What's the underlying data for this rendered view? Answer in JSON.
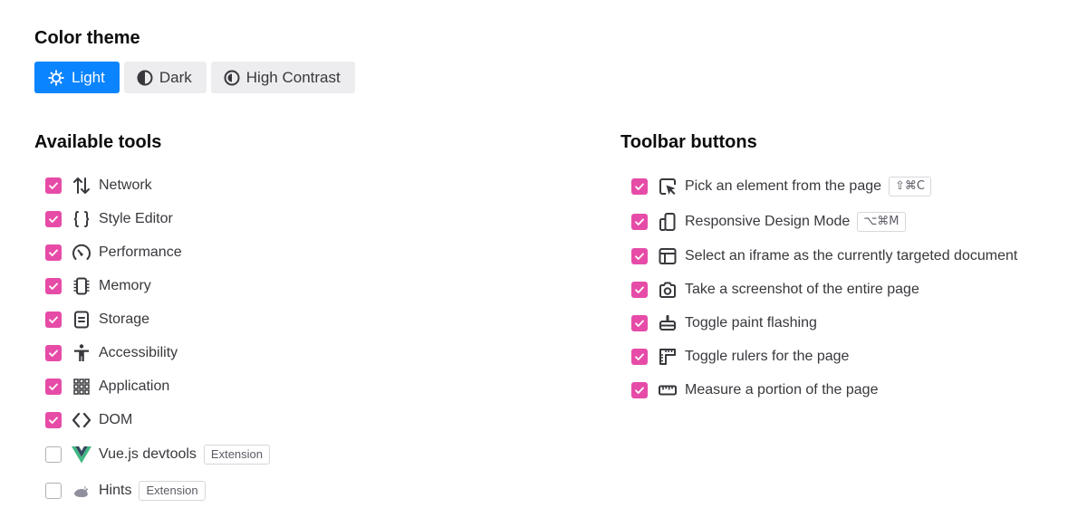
{
  "color_theme": {
    "heading": "Color theme",
    "options": [
      {
        "label": "Light",
        "icon": "sun-icon",
        "selected": true
      },
      {
        "label": "Dark",
        "icon": "half-moon-icon",
        "selected": false
      },
      {
        "label": "High Contrast",
        "icon": "contrast-icon",
        "selected": false
      }
    ],
    "colors": {
      "selected_bg": "#0a84ff",
      "unselected_bg": "#ededf0"
    }
  },
  "available_tools": {
    "heading": "Available tools",
    "items": [
      {
        "label": "Network",
        "icon": "network-arrows-icon",
        "checked": true
      },
      {
        "label": "Style Editor",
        "icon": "curly-braces-icon",
        "checked": true
      },
      {
        "label": "Performance",
        "icon": "gauge-icon",
        "checked": true
      },
      {
        "label": "Memory",
        "icon": "memory-chip-icon",
        "checked": true
      },
      {
        "label": "Storage",
        "icon": "storage-icon",
        "checked": true
      },
      {
        "label": "Accessibility",
        "icon": "accessibility-person-icon",
        "checked": true
      },
      {
        "label": "Application",
        "icon": "grid-dots-icon",
        "checked": true
      },
      {
        "label": "DOM",
        "icon": "angle-brackets-icon",
        "checked": true
      },
      {
        "label": "Vue.js devtools",
        "icon": "vue-logo-icon",
        "checked": false,
        "badge": "Extension"
      },
      {
        "label": "Hints",
        "icon": "hints-logo-icon",
        "checked": false,
        "badge": "Extension"
      }
    ]
  },
  "toolbar_buttons": {
    "heading": "Toolbar buttons",
    "items": [
      {
        "label": "Pick an element from the page",
        "icon": "element-picker-icon",
        "checked": true,
        "shortcut": "⇧⌘C"
      },
      {
        "label": "Responsive Design Mode",
        "icon": "responsive-devices-icon",
        "checked": true,
        "shortcut": "⌥⌘M"
      },
      {
        "label": "Select an iframe as the currently targeted document",
        "icon": "iframe-icon",
        "checked": true
      },
      {
        "label": "Take a screenshot of the entire page",
        "icon": "camera-icon",
        "checked": true
      },
      {
        "label": "Toggle paint flashing",
        "icon": "paint-flashing-icon",
        "checked": true
      },
      {
        "label": "Toggle rulers for the page",
        "icon": "rulers-icon",
        "checked": true
      },
      {
        "label": "Measure a portion of the page",
        "icon": "measure-ruler-icon",
        "checked": true
      }
    ]
  },
  "checkbox_color": "#e64ca7"
}
